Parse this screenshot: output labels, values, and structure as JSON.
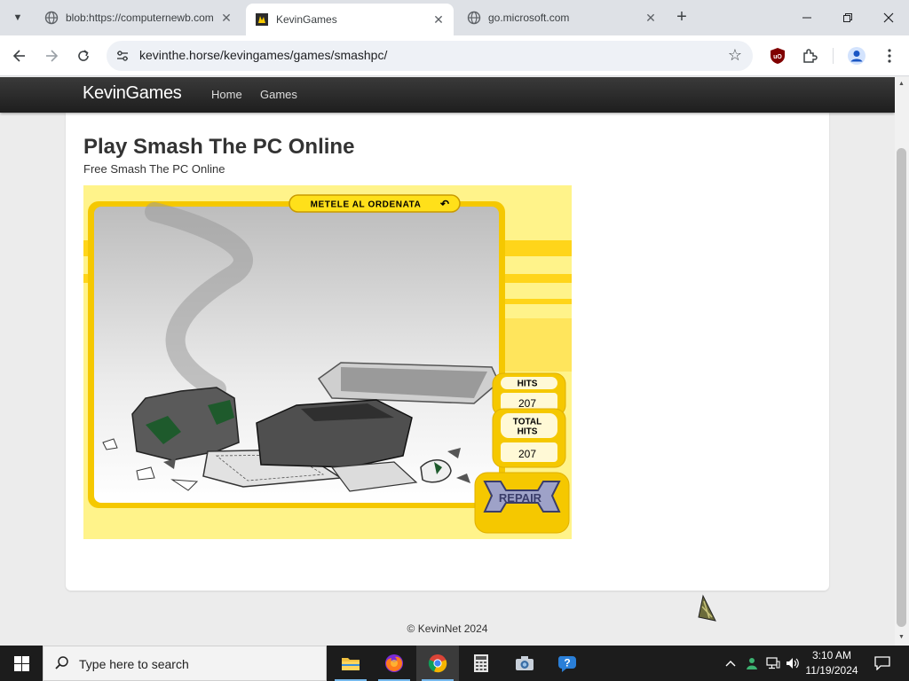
{
  "browser": {
    "tabs": [
      {
        "title": "blob:https://computernewb.com",
        "active": false
      },
      {
        "title": "KevinGames",
        "active": true
      },
      {
        "title": "go.microsoft.com",
        "active": false
      }
    ],
    "url": "kevinthe.horse/kevingames/games/smashpc/"
  },
  "site": {
    "brand": "KevinGames",
    "nav": [
      "Home",
      "Games"
    ],
    "title": "Play Smash The PC Online",
    "subtitle": "Free Smash The PC Online",
    "footer": "© KevinNet 2024"
  },
  "game": {
    "banner": "METELE AL ORDENATA",
    "hits_label": "HITS",
    "hits": "207",
    "total_label_1": "TOTAL",
    "total_label_2": "HITS",
    "total_hits": "207",
    "repair_label": "REPAIR"
  },
  "taskbar": {
    "search_placeholder": "Type here to search",
    "time": "3:10 AM",
    "date": "11/19/2024"
  },
  "colors": {
    "game_bg": "#fff38a",
    "game_frame": "#f5c800",
    "site_nav": "#222222"
  }
}
